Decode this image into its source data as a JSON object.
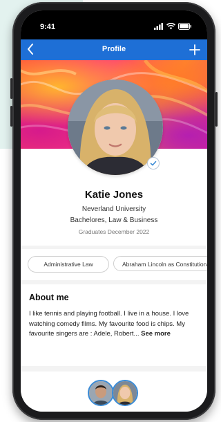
{
  "status_bar": {
    "time": "9:41"
  },
  "navbar": {
    "title": "Profile"
  },
  "profile": {
    "name": "Katie Jones",
    "university": "Neverland University",
    "degree": "Bachelores, Law & Business",
    "graduation": "Graduates December 2022"
  },
  "interests": [
    {
      "label": "Administrative Law"
    },
    {
      "label": "Abraham Lincoln as Constitutional"
    }
  ],
  "about": {
    "heading": "About me",
    "text": "I like tennis and playing football. I live in a house. I love watching comedy films. My favourite food is chips. My favourite singers are : Adele, Robert...",
    "see_more": "See more"
  },
  "colors": {
    "brand_blue": "#1e6fd6",
    "friend_ring": "#3a8bd6"
  }
}
